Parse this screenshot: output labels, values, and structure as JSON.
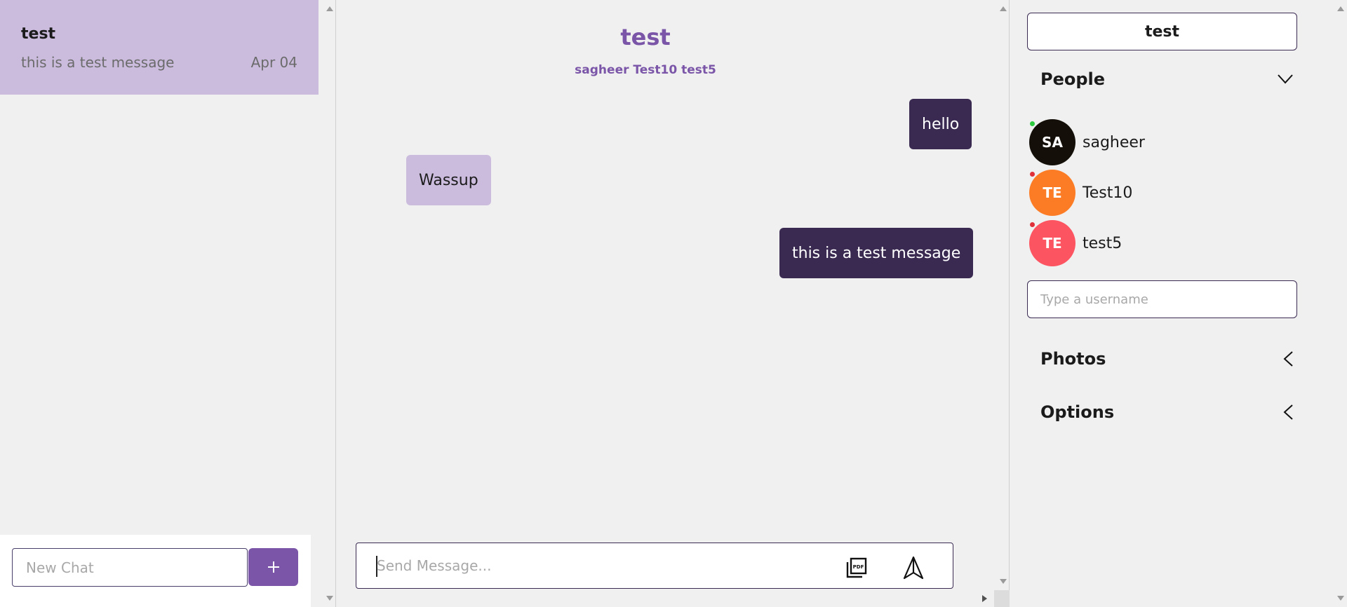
{
  "sidebar": {
    "chat": {
      "title": "test",
      "preview": "this is a test message",
      "date": "Apr 04"
    },
    "new_chat_placeholder": "New Chat",
    "add_icon": "plus-icon"
  },
  "conversation": {
    "title": "test",
    "members": "sagheer Test10 test5",
    "messages": [
      {
        "text": "hello",
        "direction": "outgoing"
      },
      {
        "text": "Wassup",
        "direction": "incoming"
      },
      {
        "text": "this is a test message",
        "direction": "outgoing"
      }
    ],
    "composer_placeholder": "Send Message...",
    "attach_icon": "pdf-icon",
    "send_icon": "send-icon"
  },
  "details": {
    "chat_name": "test",
    "people_label": "People",
    "people_icon": "chevron-down-icon",
    "people": [
      {
        "initials": "SA",
        "name": "sagheer",
        "color": "#141009",
        "status": "online",
        "status_color": "#2ecc40"
      },
      {
        "initials": "TE",
        "name": "Test10",
        "color": "#fb7c25",
        "status": "offline",
        "status_color": "#e0303a"
      },
      {
        "initials": "TE",
        "name": "test5",
        "color": "#fc5460",
        "status": "offline",
        "status_color": "#e0303a"
      }
    ],
    "username_placeholder": "Type a username",
    "photos_label": "Photos",
    "options_label": "Options",
    "collapsed_icon": "chevron-left-icon"
  },
  "colors": {
    "accent": "#7a55a8",
    "bubble_out": "#3a2a52",
    "bubble_in": "#cbbcde",
    "background": "#f0f0f0"
  }
}
